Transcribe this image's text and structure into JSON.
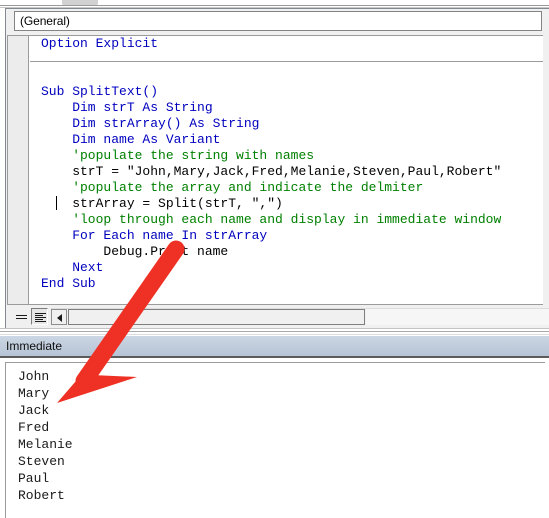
{
  "window": {
    "combo_value": "(General)",
    "combo_placeholder": "(General)"
  },
  "code_pane": {
    "lines": [
      [
        {
          "t": "Option Explicit",
          "c": "kw",
          "indent": 1
        }
      ],
      [],
      [],
      [
        {
          "t": "Sub SplitText()",
          "c": "kw",
          "indent": 1
        }
      ],
      [
        {
          "t": "Dim strT As String",
          "c": "kw",
          "indent": 2
        }
      ],
      [
        {
          "t": "Dim strArray() As String",
          "c": "kw",
          "indent": 2
        }
      ],
      [
        {
          "t": "Dim name As Variant",
          "c": "kw",
          "indent": 2
        }
      ],
      [
        {
          "t": "'populate the string with names",
          "c": "cmt",
          "indent": 2
        }
      ],
      [
        {
          "t": "strT = \"John,Mary,Jack,Fred,Melanie,Steven,Paul,Robert\"",
          "c": "txt",
          "indent": 2
        }
      ],
      [
        {
          "t": "'populate the array and indicate the delmiter",
          "c": "cmt",
          "indent": 2
        }
      ],
      [
        {
          "t": "strArray = Split(strT, \",\")",
          "c": "txt",
          "indent": 2
        }
      ],
      [
        {
          "t": "'loop through each name and display in immediate window",
          "c": "cmt",
          "indent": 2
        }
      ],
      [
        {
          "t": "For Each name In strArray",
          "c": "kw",
          "indent": 2
        }
      ],
      [
        {
          "t": "Debug.Print name",
          "c": "txt",
          "indent": 3
        }
      ],
      [
        {
          "t": "Next",
          "c": "kw",
          "indent": 2
        }
      ],
      [
        {
          "t": "End Sub",
          "c": "kw",
          "indent": 1
        }
      ]
    ]
  },
  "code_toolbar": {
    "procedure_view_label": "procedure-view",
    "full_module_view_label": "full-module-view",
    "scroll_left_label": "scroll-left"
  },
  "immediate_pane": {
    "title": "Immediate",
    "output": [
      "John",
      "Mary",
      "Jack",
      "Fred",
      "Melanie",
      "Steven",
      "Paul",
      "Robert"
    ]
  },
  "annotation": {
    "arrow_color": "#ee3124",
    "arrow_name": "red-pointer-arrow"
  },
  "colors": {
    "keyword": "#0000bf",
    "comment": "#008000",
    "text": "#000000",
    "immediate_title_bar": "#bfcbdb"
  }
}
